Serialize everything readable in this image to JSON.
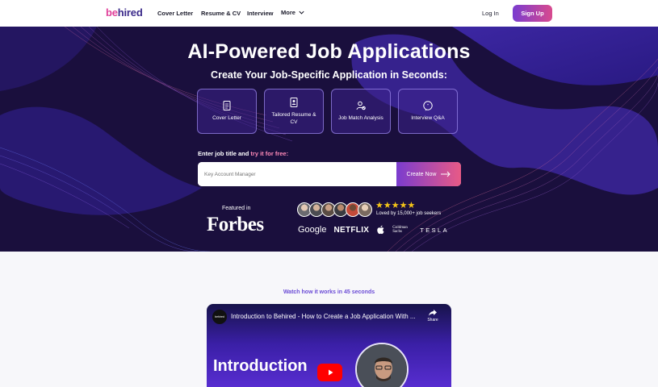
{
  "nav": {
    "logo_a": "be",
    "logo_b": "hired",
    "links": [
      "Cover Letter",
      "Resume & CV",
      "Interview",
      "More"
    ],
    "login": "Log In",
    "signup": "Sign Up"
  },
  "hero": {
    "title": "AI-Powered Job Applications",
    "subtitle": "Create Your Job-Specific Application in Seconds:",
    "cards": [
      {
        "label": "Cover Letter",
        "icon": "document-icon"
      },
      {
        "label": "Tailored Resume & CV",
        "icon": "resume-icon"
      },
      {
        "label": "Job Match Analysis",
        "icon": "user-check-icon"
      },
      {
        "label": "Interview Q&A",
        "icon": "chat-bubble-icon"
      }
    ],
    "enter_prefix": "Enter job title and ",
    "enter_highlight": "try it for free:",
    "search_placeholder": "Key Account Manager",
    "cta": "Create Now",
    "featured_in": "Featured in",
    "forbes": "Forbes",
    "stars": "★★★★★",
    "rating": 5,
    "loved": "Loved by 15,000+ job seekers",
    "logos": [
      "Google",
      "NETFLIX",
      "Apple",
      "Goldman Sachs",
      "TESLA"
    ]
  },
  "video_section": {
    "heading": "Watch how it works in 45 seconds",
    "video_title": "Introduction to Behired - How to Create a Job Application With ...",
    "channel": "behired",
    "share": "Share",
    "overlay_text": "Introduction"
  },
  "colors": {
    "brand_pink": "#e0409a",
    "brand_purple": "#3b2a8a",
    "hero_bg": "#1a0f3d",
    "accent": "#6b4cd6"
  }
}
